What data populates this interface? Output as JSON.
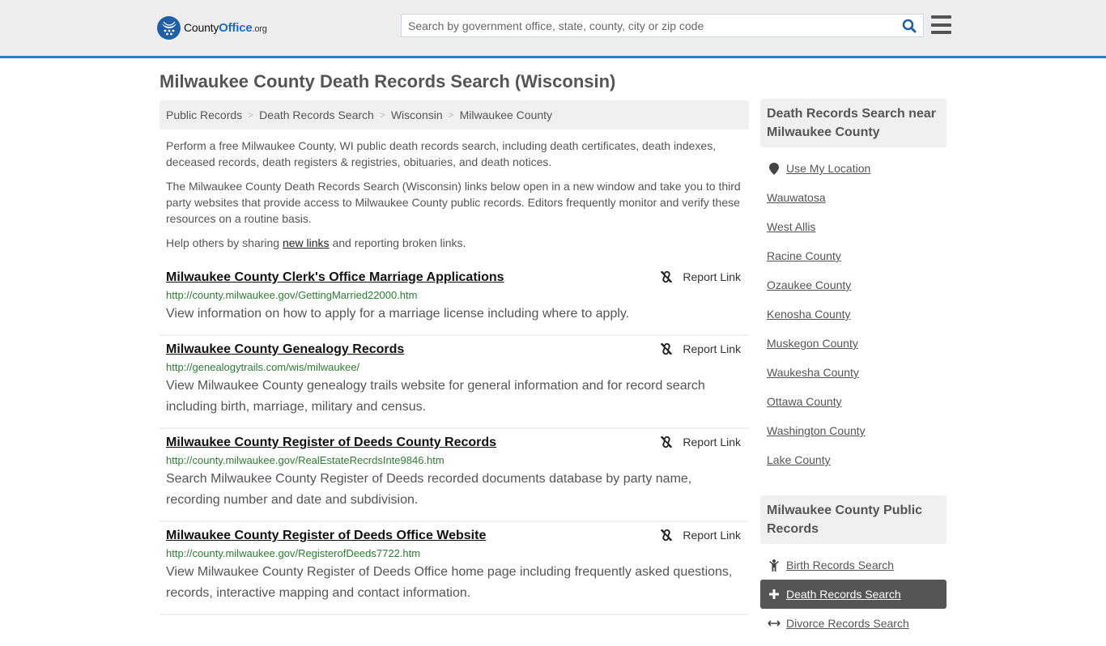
{
  "header": {
    "logo": {
      "brand_a": "County",
      "brand_b": "Office",
      "brand_c": ".org"
    },
    "search": {
      "placeholder": "Search by government office, state, county, city or zip code",
      "value": ""
    }
  },
  "page": {
    "title": "Milwaukee County Death Records Search (Wisconsin)"
  },
  "breadcrumb": [
    {
      "label": "Public Records"
    },
    {
      "label": "Death Records Search"
    },
    {
      "label": "Wisconsin"
    },
    {
      "label": "Milwaukee County"
    }
  ],
  "intro": {
    "p1": "Perform a free Milwaukee County, WI public death records search, including death certificates, death indexes, deceased records, death registers & registries, obituaries, and death notices.",
    "p2": "The Milwaukee County Death Records Search (Wisconsin) links below open in a new window and take you to third party websites that provide access to Milwaukee County public records. Editors frequently monitor and verify these resources on a routine basis.",
    "p3_before": "Help others by sharing ",
    "p3_link": "new links",
    "p3_after": " and reporting broken links."
  },
  "report_label": "Report Link",
  "results": [
    {
      "title": "Milwaukee County Clerk's Office Marriage Applications",
      "url": "http://county.milwaukee.gov/GettingMarried22000.htm",
      "description": "View information on how to apply for a marriage license including where to apply."
    },
    {
      "title": "Milwaukee County Genealogy Records",
      "url": "http://genealogytrails.com/wis/milwaukee/",
      "description": "View Milwaukee County genealogy trails website for general information and for record search including birth, marriage, military and census."
    },
    {
      "title": "Milwaukee County Register of Deeds County Records",
      "url": "http://county.milwaukee.gov/RealEstateRecrdsInte9846.htm",
      "description": "Search Milwaukee County Register of Deeds recorded documents database by party name, recording number and date and subdivision."
    },
    {
      "title": "Milwaukee County Register of Deeds Office Website",
      "url": "http://county.milwaukee.gov/RegisterofDeeds7722.htm",
      "description": "View Milwaukee County Register of Deeds Office home page including frequently asked questions, records, interactive mapping and contact information."
    }
  ],
  "sidebar": {
    "nearby_heading": "Death Records Search near Milwaukee County",
    "use_location": "Use My Location",
    "nearby": [
      "Wauwatosa",
      "West Allis",
      "Racine County",
      "Ozaukee County",
      "Kenosha County",
      "Muskegon County",
      "Waukesha County",
      "Ottawa County",
      "Washington County",
      "Lake County"
    ],
    "public_records_heading": "Milwaukee County Public Records",
    "public_records": [
      {
        "label": "Birth Records Search",
        "icon": "child-icon",
        "active": false
      },
      {
        "label": "Death Records Search",
        "icon": "plus-icon",
        "active": true
      },
      {
        "label": "Divorce Records Search",
        "icon": "arrows-horizontal-icon",
        "active": false
      }
    ]
  },
  "colors": {
    "accent": "#337ab7",
    "logo_blue": "#1f5fa5",
    "url_green": "#2e7d32",
    "active_bg": "#555555"
  }
}
